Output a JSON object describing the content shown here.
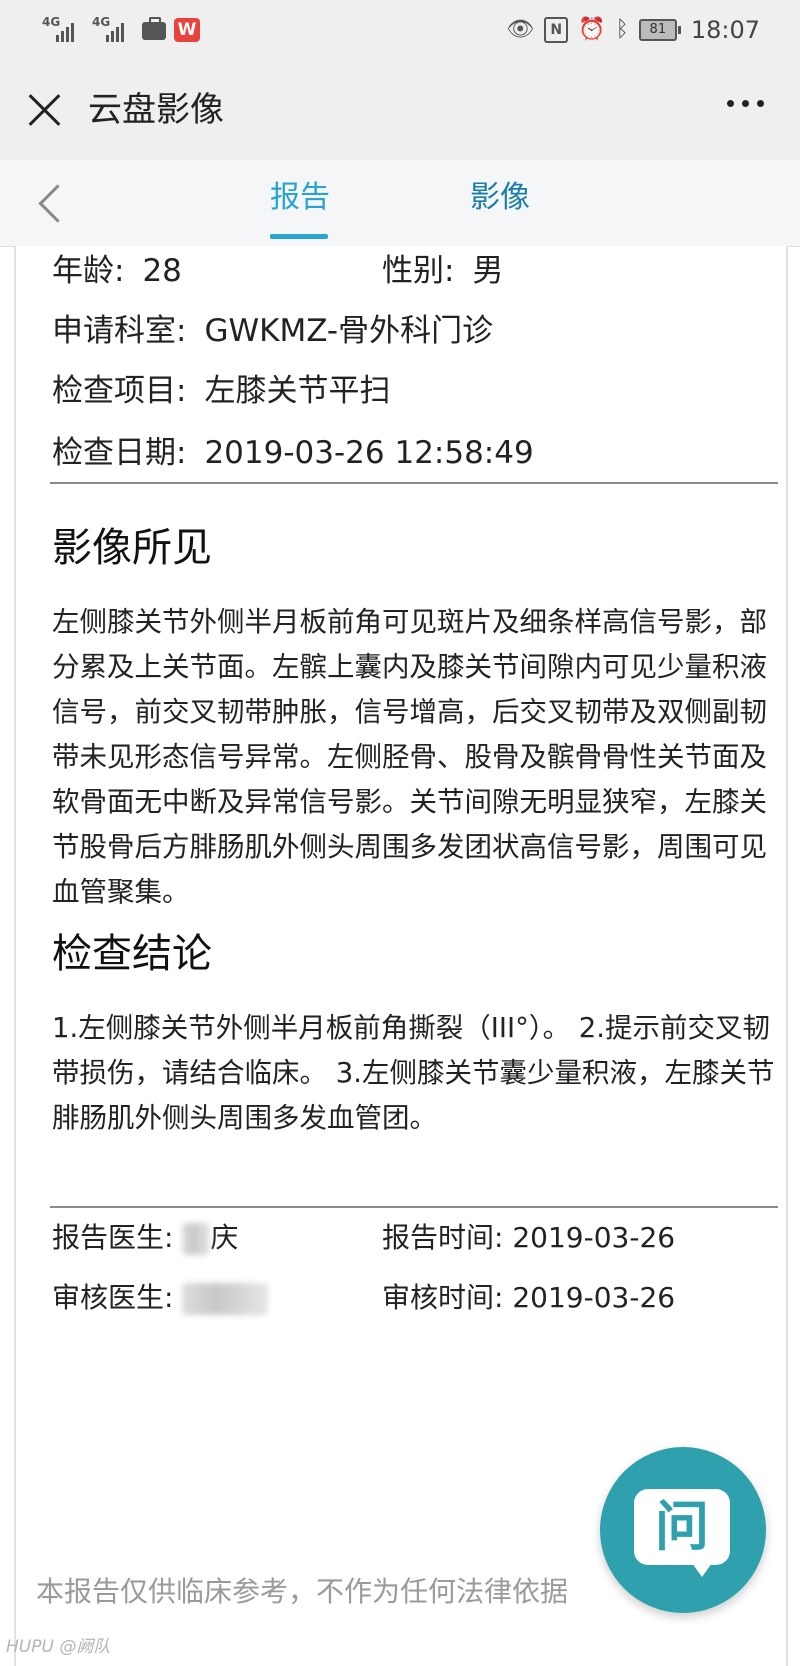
{
  "status_bar": {
    "signal1": "4G",
    "signal2": "4G",
    "badge": "W",
    "battery": "81",
    "time": "18:07",
    "icons": [
      "signal-icon",
      "briefcase-icon",
      "eye-icon",
      "nfc-icon",
      "alarm-icon",
      "bluetooth-icon",
      "battery-icon"
    ]
  },
  "titlebar": {
    "title": "云盘影像"
  },
  "tabs": [
    {
      "label": "报告",
      "active": true
    },
    {
      "label": "影像",
      "active": false
    }
  ],
  "patient": {
    "age_label": "年龄:",
    "age": "28",
    "sex_label": "性别:",
    "sex": "男",
    "dept_label": "申请科室:",
    "dept": "GWKMZ-骨外科门诊",
    "item_label": "检查项目:",
    "item": "左膝关节平扫",
    "date_label": "检查日期:",
    "date": "2019-03-26 12:58:49"
  },
  "findings": {
    "title": "影像所见",
    "text": "左侧膝关节外侧半月板前角可见斑片及细条样高信号影，部分累及上关节面。左髌上囊内及膝关节间隙内可见少量积液信号，前交叉韧带肿胀，信号增高，后交叉韧带及双侧副韧带未见形态信号异常。左侧胫骨、股骨及髌骨骨性关节面及软骨面无中断及异常信号影。关节间隙无明显狭窄，左膝关节股骨后方腓肠肌外侧头周围多发团状高信号影，周围可见血管聚集。"
  },
  "conclusion": {
    "title": "检查结论",
    "text": "1.左侧膝关节外侧半月板前角撕裂（III°）。 2.提示前交叉韧带损伤，请结合临床。 3.左侧膝关节囊少量积液，左膝关节腓肠肌外侧头周围多发血管团。"
  },
  "signoff": {
    "doctor_label": "报告医生:",
    "doctor_partial": "庆",
    "report_time_label": "报告时间:",
    "report_time": "2019-03-26",
    "reviewer_label": "审核医生:",
    "review_time_label": "审核时间:",
    "review_time": "2019-03-26"
  },
  "disclaimer": "本报告仅供临床参考，不作为任何法律依据",
  "ask_button": "问",
  "watermark": "HUPU @阙队"
}
